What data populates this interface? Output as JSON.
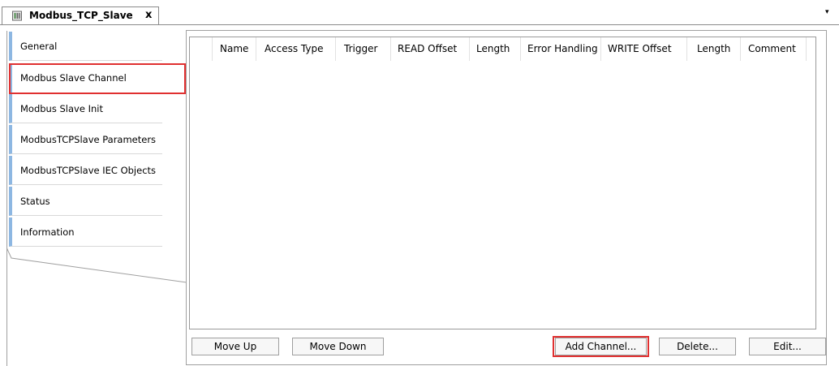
{
  "tab": {
    "title": "Modbus_TCP_Slave",
    "close_label": "x",
    "dropdown_icon": "▾"
  },
  "sidebar": {
    "items": [
      {
        "label": "General"
      },
      {
        "label": "Modbus Slave Channel"
      },
      {
        "label": "Modbus Slave Init"
      },
      {
        "label": "ModbusTCPSlave Parameters"
      },
      {
        "label": "ModbusTCPSlave IEC Objects"
      },
      {
        "label": "Status"
      },
      {
        "label": "Information"
      }
    ],
    "selected": "Modbus Slave Channel"
  },
  "table": {
    "columns": [
      "Name",
      "Access Type",
      "Trigger",
      "READ Offset",
      "Length",
      "Error Handling",
      "WRITE Offset",
      "Length",
      "Comment"
    ],
    "rows": []
  },
  "buttons": {
    "move_up": "Move Up",
    "move_down": "Move Down",
    "add_channel": "Add Channel...",
    "delete": "Delete...",
    "edit": "Edit..."
  },
  "colors": {
    "accent": "#8db7e2",
    "highlight": "#e03030"
  }
}
